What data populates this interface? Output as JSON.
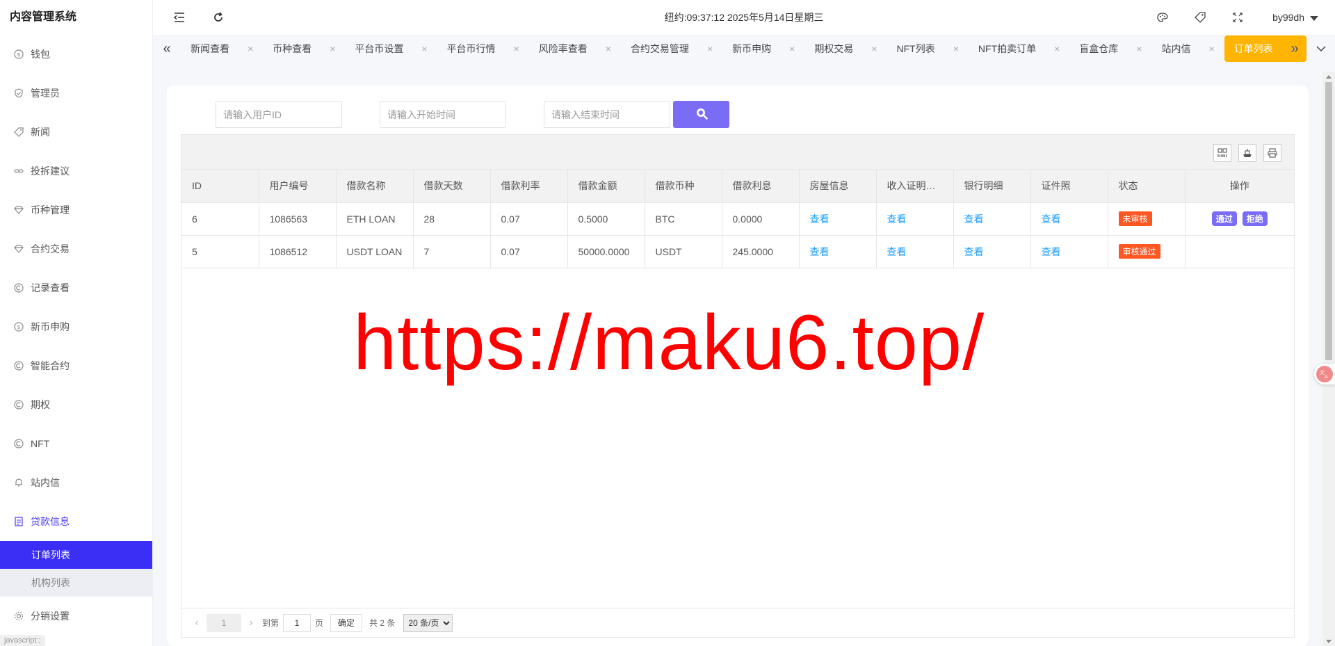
{
  "app": {
    "title": "内容管理系统"
  },
  "header": {
    "clock": "纽约:09:37:12 2025年5月14日星期三",
    "user": "by99dh"
  },
  "sidebar": {
    "items": [
      {
        "label": "钱包",
        "icon": "dollar-circle-icon"
      },
      {
        "label": "管理员",
        "icon": "shield-icon"
      },
      {
        "label": "新闻",
        "icon": "tag-icon"
      },
      {
        "label": "投拆建议",
        "icon": "link-icon"
      },
      {
        "label": "币种管理",
        "icon": "diamond-icon"
      },
      {
        "label": "合约交易",
        "icon": "diamond-icon"
      },
      {
        "label": "记录查看",
        "icon": "refresh-circle-icon"
      },
      {
        "label": "新币申购",
        "icon": "dollar-circle-icon"
      },
      {
        "label": "智能合约",
        "icon": "refresh-circle-icon"
      },
      {
        "label": "期权",
        "icon": "refresh-circle-icon"
      },
      {
        "label": "NFT",
        "icon": "refresh-circle-icon"
      },
      {
        "label": "站内信",
        "icon": "bell-icon"
      },
      {
        "label": "贷款信息",
        "icon": "document-icon"
      }
    ],
    "sub_items": [
      {
        "label": "订单列表"
      },
      {
        "label": "机构列表"
      }
    ],
    "after_items": [
      {
        "label": "分销设置",
        "icon": "gear-icon"
      }
    ],
    "status_hint": "javascript:;"
  },
  "tabs": [
    {
      "label": "新闻查看"
    },
    {
      "label": "币种查看"
    },
    {
      "label": "平台币设置"
    },
    {
      "label": "平台币行情"
    },
    {
      "label": "风险率查看"
    },
    {
      "label": "合约交易管理"
    },
    {
      "label": "新币申购"
    },
    {
      "label": "期权交易"
    },
    {
      "label": "NFT列表"
    },
    {
      "label": "NFT拍卖订单"
    },
    {
      "label": "盲盒仓库"
    },
    {
      "label": "站内信"
    },
    {
      "label": "订单列表"
    }
  ],
  "tab_close": "×",
  "search": {
    "user_id_placeholder": "请输入用户ID",
    "start_placeholder": "请输入开始时间",
    "end_placeholder": "请输入结束时间"
  },
  "table": {
    "columns": [
      "ID",
      "用户编号",
      "借款名称",
      "借款天数",
      "借款利率",
      "借款金额",
      "借款币种",
      "借款利息",
      "房屋信息",
      "收入证明（...",
      "银行明细",
      "证件照",
      "状态",
      "操作"
    ],
    "rows": [
      {
        "id": "6",
        "user_no": "1086563",
        "name": "ETH LOAN",
        "days": "28",
        "rate": "0.07",
        "amount": "0.5000",
        "currency": "BTC",
        "interest": "0.0000",
        "house": "查看",
        "income": "查看",
        "bank": "查看",
        "idphoto": "查看",
        "status": "未审核",
        "actions": [
          "通过",
          "拒绝"
        ]
      },
      {
        "id": "5",
        "user_no": "1086512",
        "name": "USDT LOAN",
        "days": "7",
        "rate": "0.07",
        "amount": "50000.0000",
        "currency": "USDT",
        "interest": "245.0000",
        "house": "查看",
        "income": "查看",
        "bank": "查看",
        "idphoto": "查看",
        "status": "审核通过",
        "actions": []
      }
    ]
  },
  "watermark": "https://maku6.top/",
  "pager": {
    "current": "1",
    "goto_label": "到第",
    "goto_value": "1",
    "page_unit": "页",
    "confirm": "确定",
    "total": "共 2 条",
    "page_size": "20 条/页"
  },
  "colors": {
    "accent": "#3b2ff5",
    "active_tab": "#ffb400",
    "search_button": "#7b6cf6",
    "link": "#1e9fff",
    "status_badge": "#ff5722",
    "watermark": "#ff0000"
  }
}
